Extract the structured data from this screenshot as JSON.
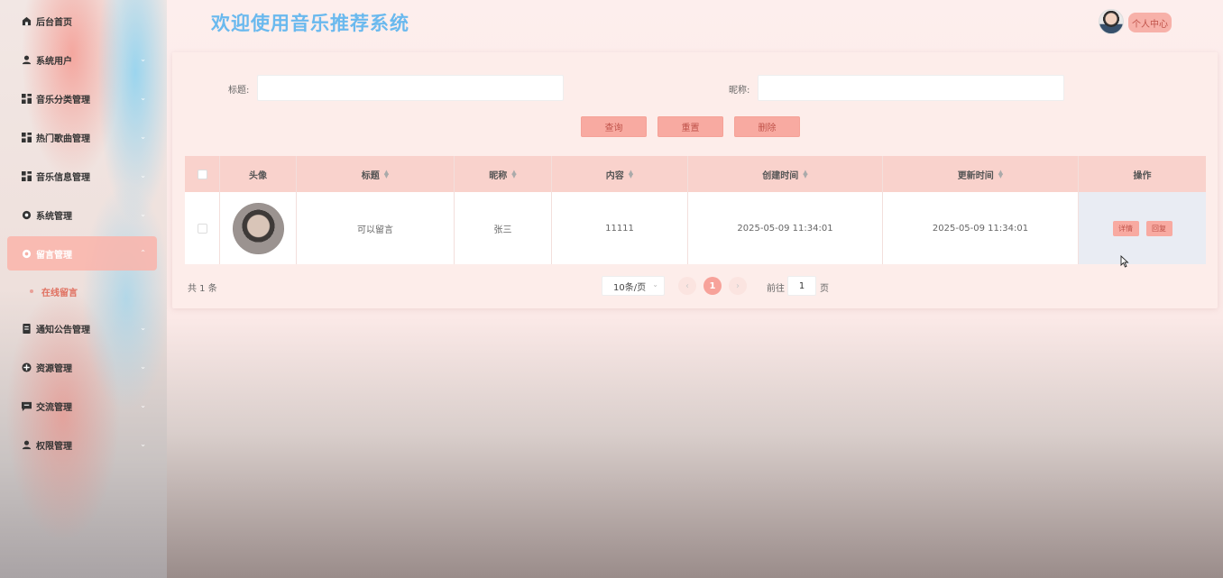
{
  "app": {
    "title": "欢迎使用音乐推荐系统"
  },
  "header": {
    "personal_center": "个人中心"
  },
  "sidebar": {
    "items": [
      {
        "label": "后台首页",
        "icon": "home-icon"
      },
      {
        "label": "系统用户",
        "icon": "user-icon"
      },
      {
        "label": "音乐分类管理",
        "icon": "grid-icon"
      },
      {
        "label": "热门歌曲管理",
        "icon": "grid-icon"
      },
      {
        "label": "音乐信息管理",
        "icon": "grid-icon"
      },
      {
        "label": "系统管理",
        "icon": "gear-icon"
      },
      {
        "label": "留言管理",
        "icon": "gear-icon",
        "active": true
      },
      {
        "label": "通知公告管理",
        "icon": "document-icon"
      },
      {
        "label": "资源管理",
        "icon": "plus-circle-icon"
      },
      {
        "label": "交流管理",
        "icon": "chat-icon"
      },
      {
        "label": "权限管理",
        "icon": "user-icon"
      }
    ],
    "sub_item": "在线留言"
  },
  "search": {
    "title_label": "标题:",
    "title_value": "",
    "nickname_label": "昵称:",
    "nickname_value": ""
  },
  "buttons": {
    "query": "查询",
    "reset": "重置",
    "delete": "删除"
  },
  "table": {
    "headers": {
      "avatar": "头像",
      "title": "标题",
      "nickname": "昵称",
      "content": "内容",
      "created": "创建时间",
      "updated": "更新时间",
      "actions": "操作"
    },
    "rows": [
      {
        "title": "可以留言",
        "nickname": "张三",
        "content": "11111",
        "created": "2025-05-09 11:34:01",
        "updated": "2025-05-09 11:34:01",
        "detail": "详情",
        "reply": "回复"
      }
    ]
  },
  "pagination": {
    "total": "共 1 条",
    "page_size": "10条/页",
    "current_page": "1",
    "goto_prefix": "前往",
    "goto_value": "1",
    "goto_suffix": "页"
  },
  "colors": {
    "accent": "#f8aaa1",
    "title": "#6ab9ee",
    "header_row": "#f9d2cc"
  }
}
